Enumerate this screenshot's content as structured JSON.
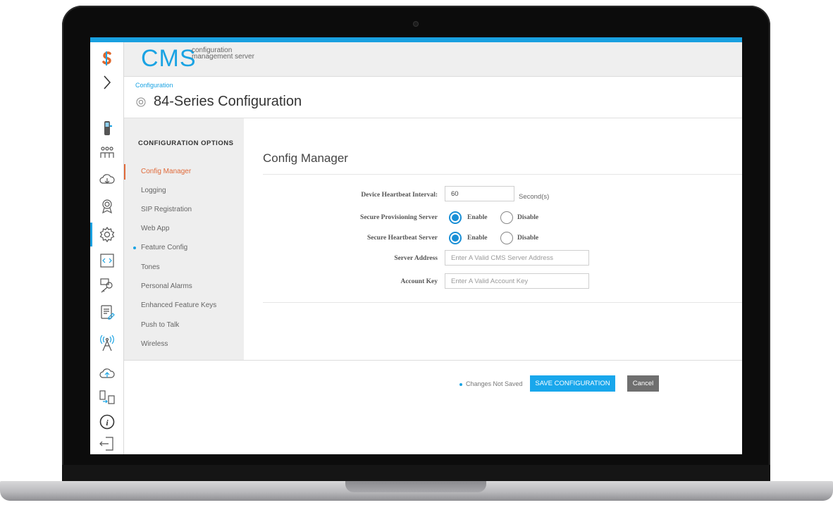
{
  "app": {
    "logo_text": "CMS",
    "logo_subtitle": "configuration management server"
  },
  "rail": {
    "icons": [
      "app-logo-icon",
      "expand-chevron-icon",
      "phone-device-icon",
      "users-group-icon",
      "cloud-download-icon",
      "certificate-icon",
      "settings-gear-icon",
      "xml-code-icon",
      "key-search-icon",
      "edit-document-icon",
      "antenna-tower-icon",
      "cloud-upload-icon",
      "device-transfer-icon",
      "info-icon",
      "logout-icon"
    ],
    "active": "settings-gear-icon"
  },
  "breadcrumb": "Configuration",
  "page_title": "84-Series Configuration",
  "options": {
    "heading": "CONFIGURATION OPTIONS",
    "items": [
      {
        "label": "Config Manager",
        "active": true
      },
      {
        "label": "Logging"
      },
      {
        "label": "SIP Registration"
      },
      {
        "label": "Web App"
      },
      {
        "label": "Feature Config",
        "marked": true
      },
      {
        "label": "Tones"
      },
      {
        "label": "Personal Alarms"
      },
      {
        "label": "Enhanced Feature Keys"
      },
      {
        "label": "Push to Talk"
      },
      {
        "label": "Wireless"
      }
    ]
  },
  "form": {
    "section_title": "Config Manager",
    "heartbeat_label": "Device Heartbeat Interval:",
    "heartbeat_value": "60",
    "heartbeat_unit": "Second(s)",
    "secure_prov_label": "Secure Provisioning Server",
    "secure_hb_label": "Secure Heartbeat Server",
    "enable_label": "Enable",
    "disable_label": "Disable",
    "secure_prov_value": "Enable",
    "secure_hb_value": "Enable",
    "server_address_label": "Server Address",
    "server_address_placeholder": "Enter A Valid CMS Server Address",
    "account_key_label": "Account Key",
    "account_key_placeholder": "Enter A Valid Account Key"
  },
  "footer": {
    "status": "Changes Not Saved",
    "save_label": "SAVE CONFIGURATION",
    "cancel_label": "Cancel"
  },
  "colors": {
    "accent": "#19a0e0",
    "active_option": "#e06a3a",
    "save_button": "#19a7ec",
    "cancel_button": "#6f6f6f"
  }
}
